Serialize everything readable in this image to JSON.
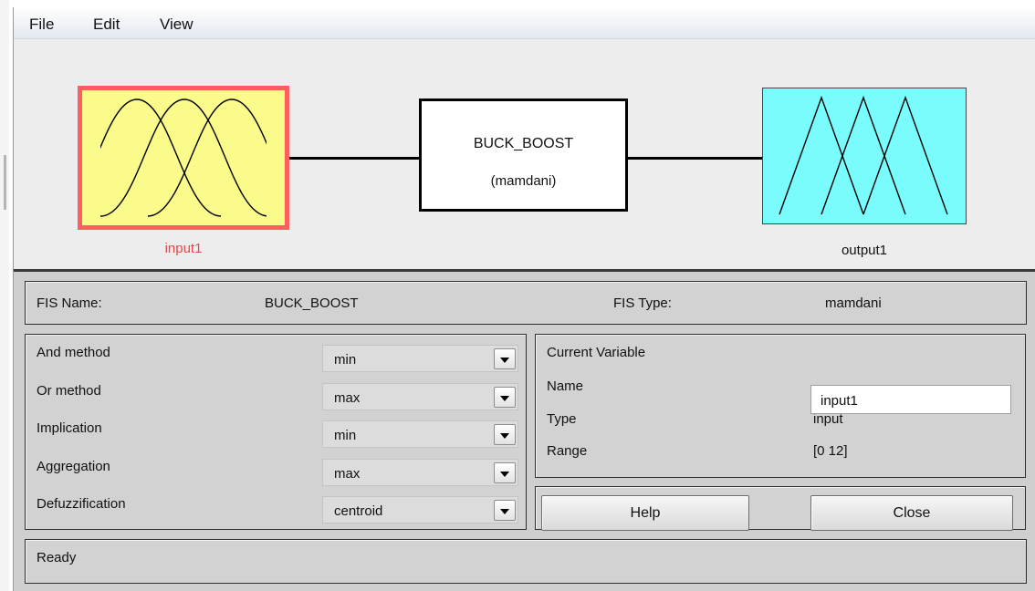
{
  "menu": {
    "file": "File",
    "edit": "Edit",
    "view": "View"
  },
  "diagram": {
    "input_label": "input1",
    "system_name": "BUCK_BOOST",
    "system_type": "(mamdani)",
    "output_label": "output1"
  },
  "fis": {
    "name_label": "FIS Name:",
    "name_value": "BUCK_BOOST",
    "type_label": "FIS Type:",
    "type_value": "mamdani"
  },
  "methods": [
    {
      "label": "And method",
      "value": "min"
    },
    {
      "label": "Or method",
      "value": "max"
    },
    {
      "label": "Implication",
      "value": "min"
    },
    {
      "label": "Aggregation",
      "value": "max"
    },
    {
      "label": "Defuzzification",
      "value": "centroid"
    }
  ],
  "current_variable": {
    "title": "Current Variable",
    "name_label": "Name",
    "name_value": "input1",
    "type_label": "Type",
    "type_value": "input",
    "range_label": "Range",
    "range_value": "[0 12]"
  },
  "buttons": {
    "help": "Help",
    "close": "Close"
  },
  "status": "Ready",
  "colors": {
    "input_fill": "#fbfb8c",
    "input_border": "#ff5e5e",
    "output_fill": "#7bfcfc",
    "input_label_color": "#e04a4a"
  }
}
